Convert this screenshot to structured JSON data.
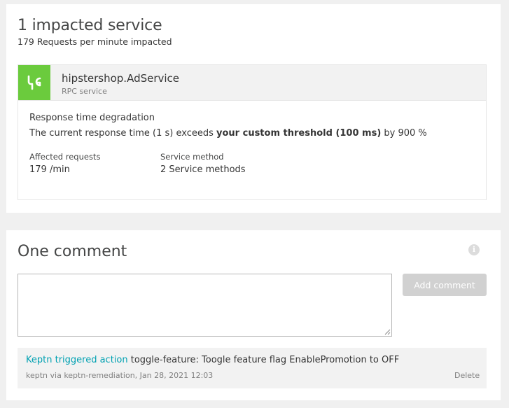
{
  "impact": {
    "title": "1 impacted service",
    "subtitle": "179 Requests per minute impacted"
  },
  "service": {
    "name": "hipstershop.AdService",
    "type": "RPC service",
    "icon": "service-icon",
    "icon_color": "#6bcb3d",
    "degradation_title": "Response time degradation",
    "detail_prefix": "The current response time (1 s) exceeds ",
    "detail_bold": "your custom threshold (100 ms)",
    "detail_suffix": " by 900 %",
    "affected_label": "Affected requests",
    "affected_value": "179 /min",
    "method_label": "Service method",
    "method_value": "2 Service methods"
  },
  "comments": {
    "title": "One comment",
    "input_value": "",
    "add_button": "Add comment",
    "info_icon": "info-icon",
    "items": [
      {
        "link": "Keptn triggered action",
        "text": " toggle-feature: Toogle feature flag EnablePromotion to OFF",
        "meta": "keptn via keptn-remediation, Jan 28, 2021 12:03",
        "delete": "Delete"
      }
    ]
  },
  "colors": {
    "accent_link": "#00a1b2",
    "service_green": "#6bcb3d",
    "disabled_button": "#d1d1d1"
  }
}
